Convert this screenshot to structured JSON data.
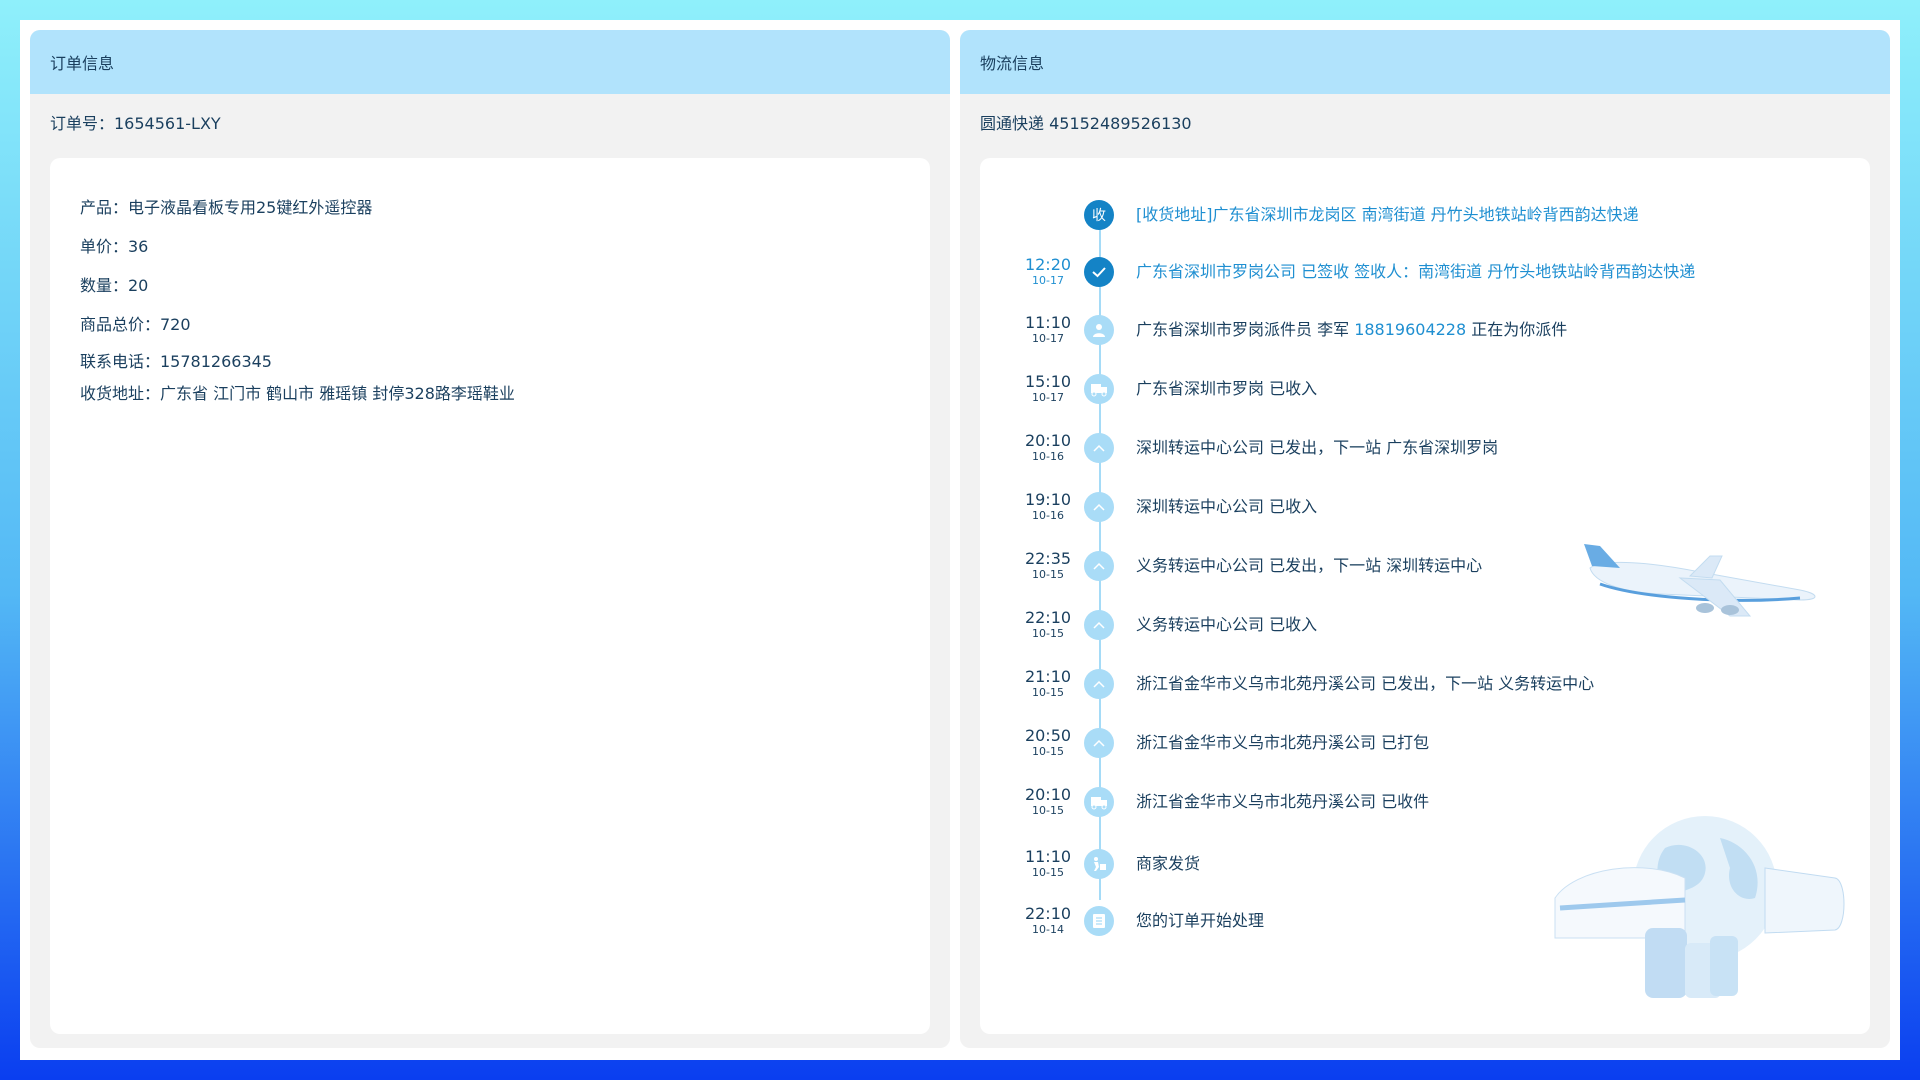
{
  "order": {
    "header": "订单信息",
    "order_no": "订单号：1654561-LXY",
    "product": "产品：电子液晶看板专用25键红外遥控器",
    "unit_price": "单价：36",
    "quantity": "数量：20",
    "total": "商品总价：720",
    "phone": "联系电话：15781266345",
    "address": "收货地址：广东省 江门市 鹤山市 雅瑶镇 封停328路李瑶鞋业"
  },
  "logistics": {
    "header": "物流信息",
    "carrier": "圆通快递  45152489526130",
    "timeline": [
      {
        "icon": "收",
        "time": "",
        "date": "",
        "text": "[收货地址]广东省深圳市龙岗区  南湾街道  丹竹头地铁站岭背西韵达快递",
        "active": true
      },
      {
        "icon": "check-icon",
        "time": "12:20",
        "date": "10-17",
        "text": "广东省深圳市罗岗公司  已签收 签收人：南湾街道  丹竹头地铁站岭背西韵达快递",
        "active": true
      },
      {
        "icon": "courier-icon",
        "time": "11:10",
        "date": "10-17",
        "text": "广东省深圳市罗岗派件员 李军 ",
        "phone": "18819604228",
        "text_after": " 正在为你派件",
        "active": false
      },
      {
        "icon": "warehouse-icon",
        "time": "15:10",
        "date": "10-17",
        "text": "广东省深圳市罗岗 已收入",
        "active": false
      },
      {
        "icon": "chevron-up-icon",
        "time": "20:10",
        "date": "10-16",
        "text": "深圳转运中心公司 已发出，下一站 广东省深圳罗岗",
        "active": false
      },
      {
        "icon": "chevron-up-icon",
        "time": "19:10",
        "date": "10-16",
        "text": "深圳转运中心公司 已收入",
        "active": false
      },
      {
        "icon": "chevron-up-icon",
        "time": "22:35",
        "date": "10-15",
        "text": "义务转运中心公司 已发出，下一站 深圳转运中心",
        "active": false
      },
      {
        "icon": "chevron-up-icon",
        "time": "22:10",
        "date": "10-15",
        "text": "义务转运中心公司 已收入",
        "active": false
      },
      {
        "icon": "chevron-up-icon",
        "time": "21:10",
        "date": "10-15",
        "text": "浙江省金华市义乌市北苑丹溪公司 已发出，下一站 义务转运中心",
        "active": false
      },
      {
        "icon": "chevron-up-icon",
        "time": "20:50",
        "date": "10-15",
        "text": "浙江省金华市义乌市北苑丹溪公司 已打包",
        "active": false
      },
      {
        "icon": "warehouse-icon",
        "time": "20:10",
        "date": "10-15",
        "text": "浙江省金华市义乌市北苑丹溪公司 已收件",
        "active": false
      },
      {
        "icon": "shipper-icon",
        "time": "11:10",
        "date": "10-15",
        "text": "商家发货",
        "active": false
      },
      {
        "icon": "document-icon",
        "time": "22:10",
        "date": "10-14",
        "text": "您的订单开始处理",
        "active": false
      }
    ]
  },
  "colors": {
    "header_bg": "#b1e3fc",
    "accent": "#1f8fd1",
    "dot_dark": "#1483c6",
    "dot_light": "#a9dcf7",
    "text": "#1a3f5e"
  }
}
